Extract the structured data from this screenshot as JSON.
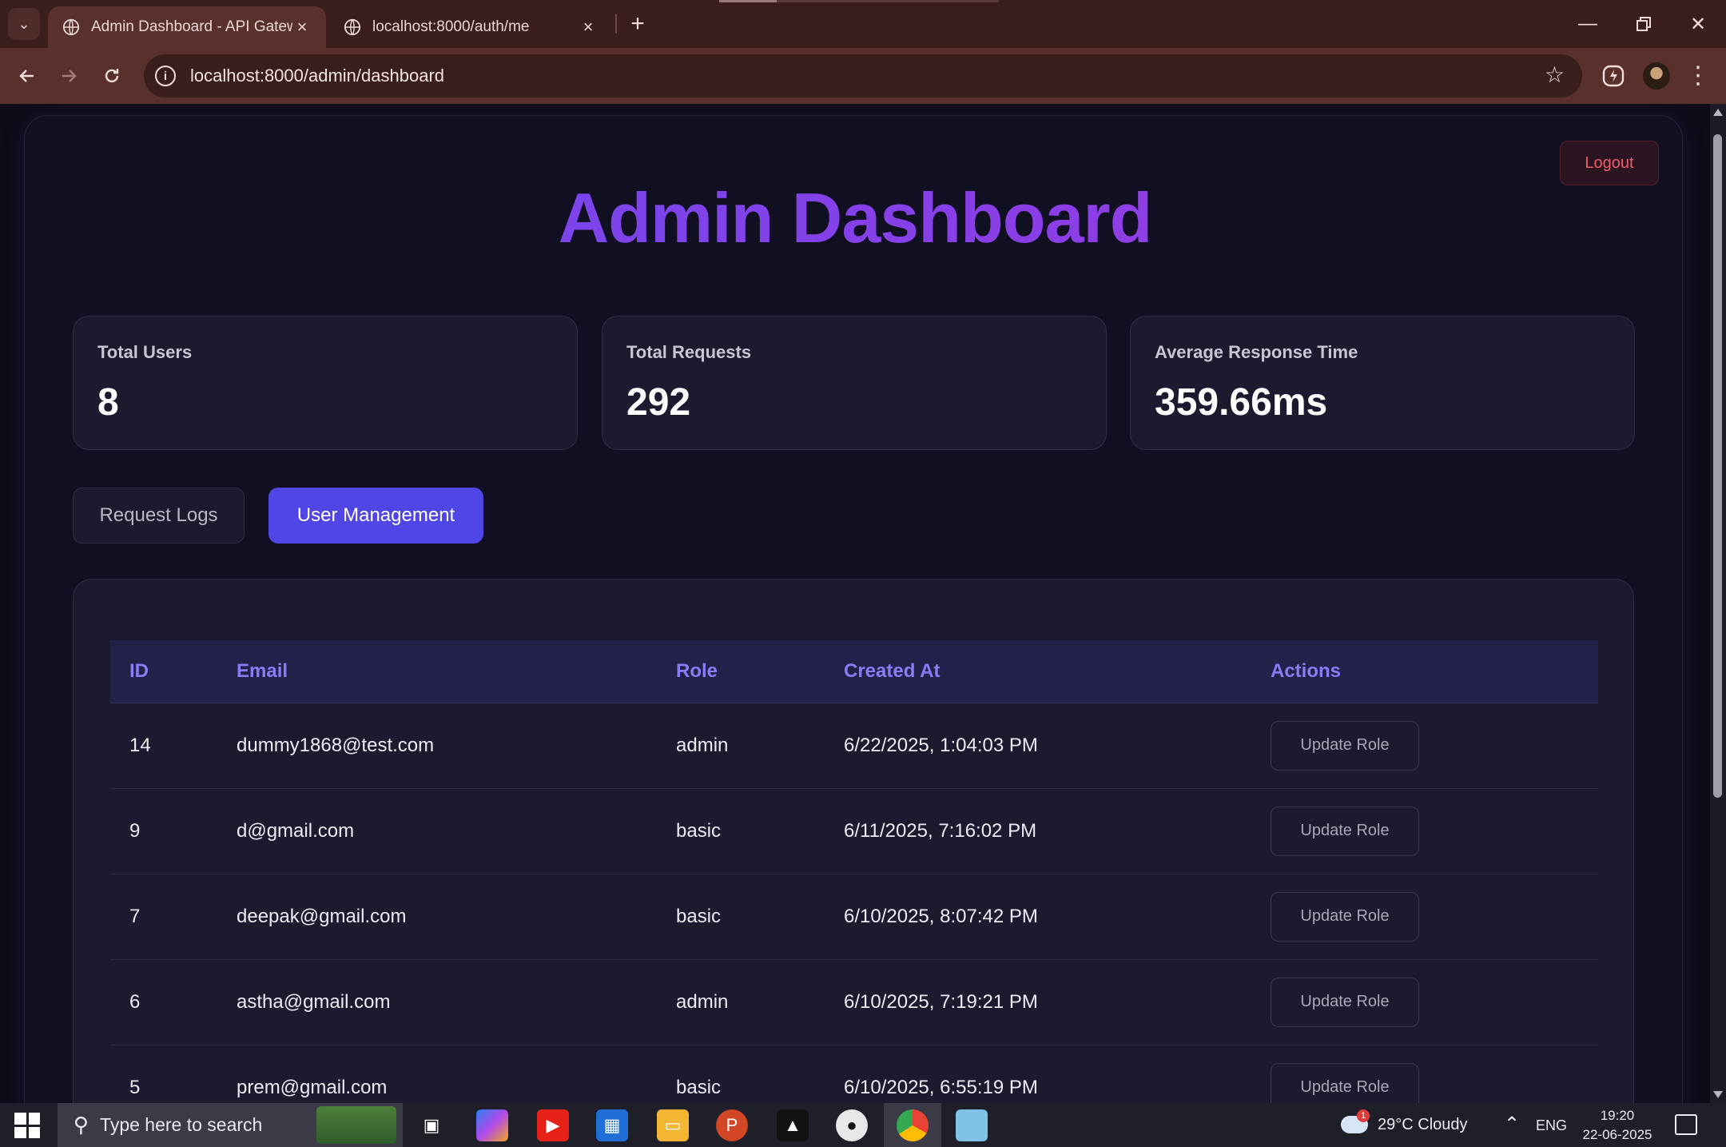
{
  "browser": {
    "tabs": [
      {
        "title": "Admin Dashboard - API Gatewa",
        "active": true
      },
      {
        "title": "localhost:8000/auth/me",
        "active": false
      }
    ],
    "new_tab_symbol": "+",
    "url": "localhost:8000/admin/dashboard"
  },
  "page": {
    "logout_label": "Logout",
    "title": "Admin Dashboard",
    "stats": [
      {
        "label": "Total Users",
        "value": "8"
      },
      {
        "label": "Total Requests",
        "value": "292"
      },
      {
        "label": "Average Response Time",
        "value": "359.66ms"
      }
    ],
    "tabs": [
      {
        "label": "Request Logs",
        "active": false
      },
      {
        "label": "User Management",
        "active": true
      }
    ],
    "table": {
      "headers": [
        "ID",
        "Email",
        "Role",
        "Created At",
        "Actions"
      ],
      "rows": [
        {
          "id": "14",
          "email": "dummy1868@test.com",
          "role": "admin",
          "created_at": "6/22/2025, 1:04:03 PM",
          "action": "Update Role"
        },
        {
          "id": "9",
          "email": "d@gmail.com",
          "role": "basic",
          "created_at": "6/11/2025, 7:16:02 PM",
          "action": "Update Role"
        },
        {
          "id": "7",
          "email": "deepak@gmail.com",
          "role": "basic",
          "created_at": "6/10/2025, 8:07:42 PM",
          "action": "Update Role"
        },
        {
          "id": "6",
          "email": "astha@gmail.com",
          "role": "admin",
          "created_at": "6/10/2025, 7:19:21 PM",
          "action": "Update Role"
        },
        {
          "id": "5",
          "email": "prem@gmail.com",
          "role": "basic",
          "created_at": "6/10/2025, 6:55:19 PM",
          "action": "Update Role"
        }
      ]
    }
  },
  "taskbar": {
    "search_placeholder": "Type here to search",
    "weather": "29°C  Cloudy",
    "weather_badge": "1",
    "language": "ENG",
    "time": "19:20",
    "date": "22-06-2025"
  },
  "colors": {
    "accent": "#4f46e5",
    "title_gradient_start": "#6a4cf0",
    "title_gradient_end": "#a040e0",
    "header_text": "#8b7cf6",
    "logout_text": "#f25c6a",
    "background": "#0d0c18",
    "card": "#1b1a2e"
  },
  "icons": {
    "tab_favicon": "globe-icon",
    "back": "back-arrow-icon",
    "forward": "forward-arrow-icon",
    "reload": "reload-icon",
    "site_info": "info-icon",
    "bookmark": "star-icon",
    "extension": "extension-icon",
    "menu": "kebab-menu-icon"
  }
}
